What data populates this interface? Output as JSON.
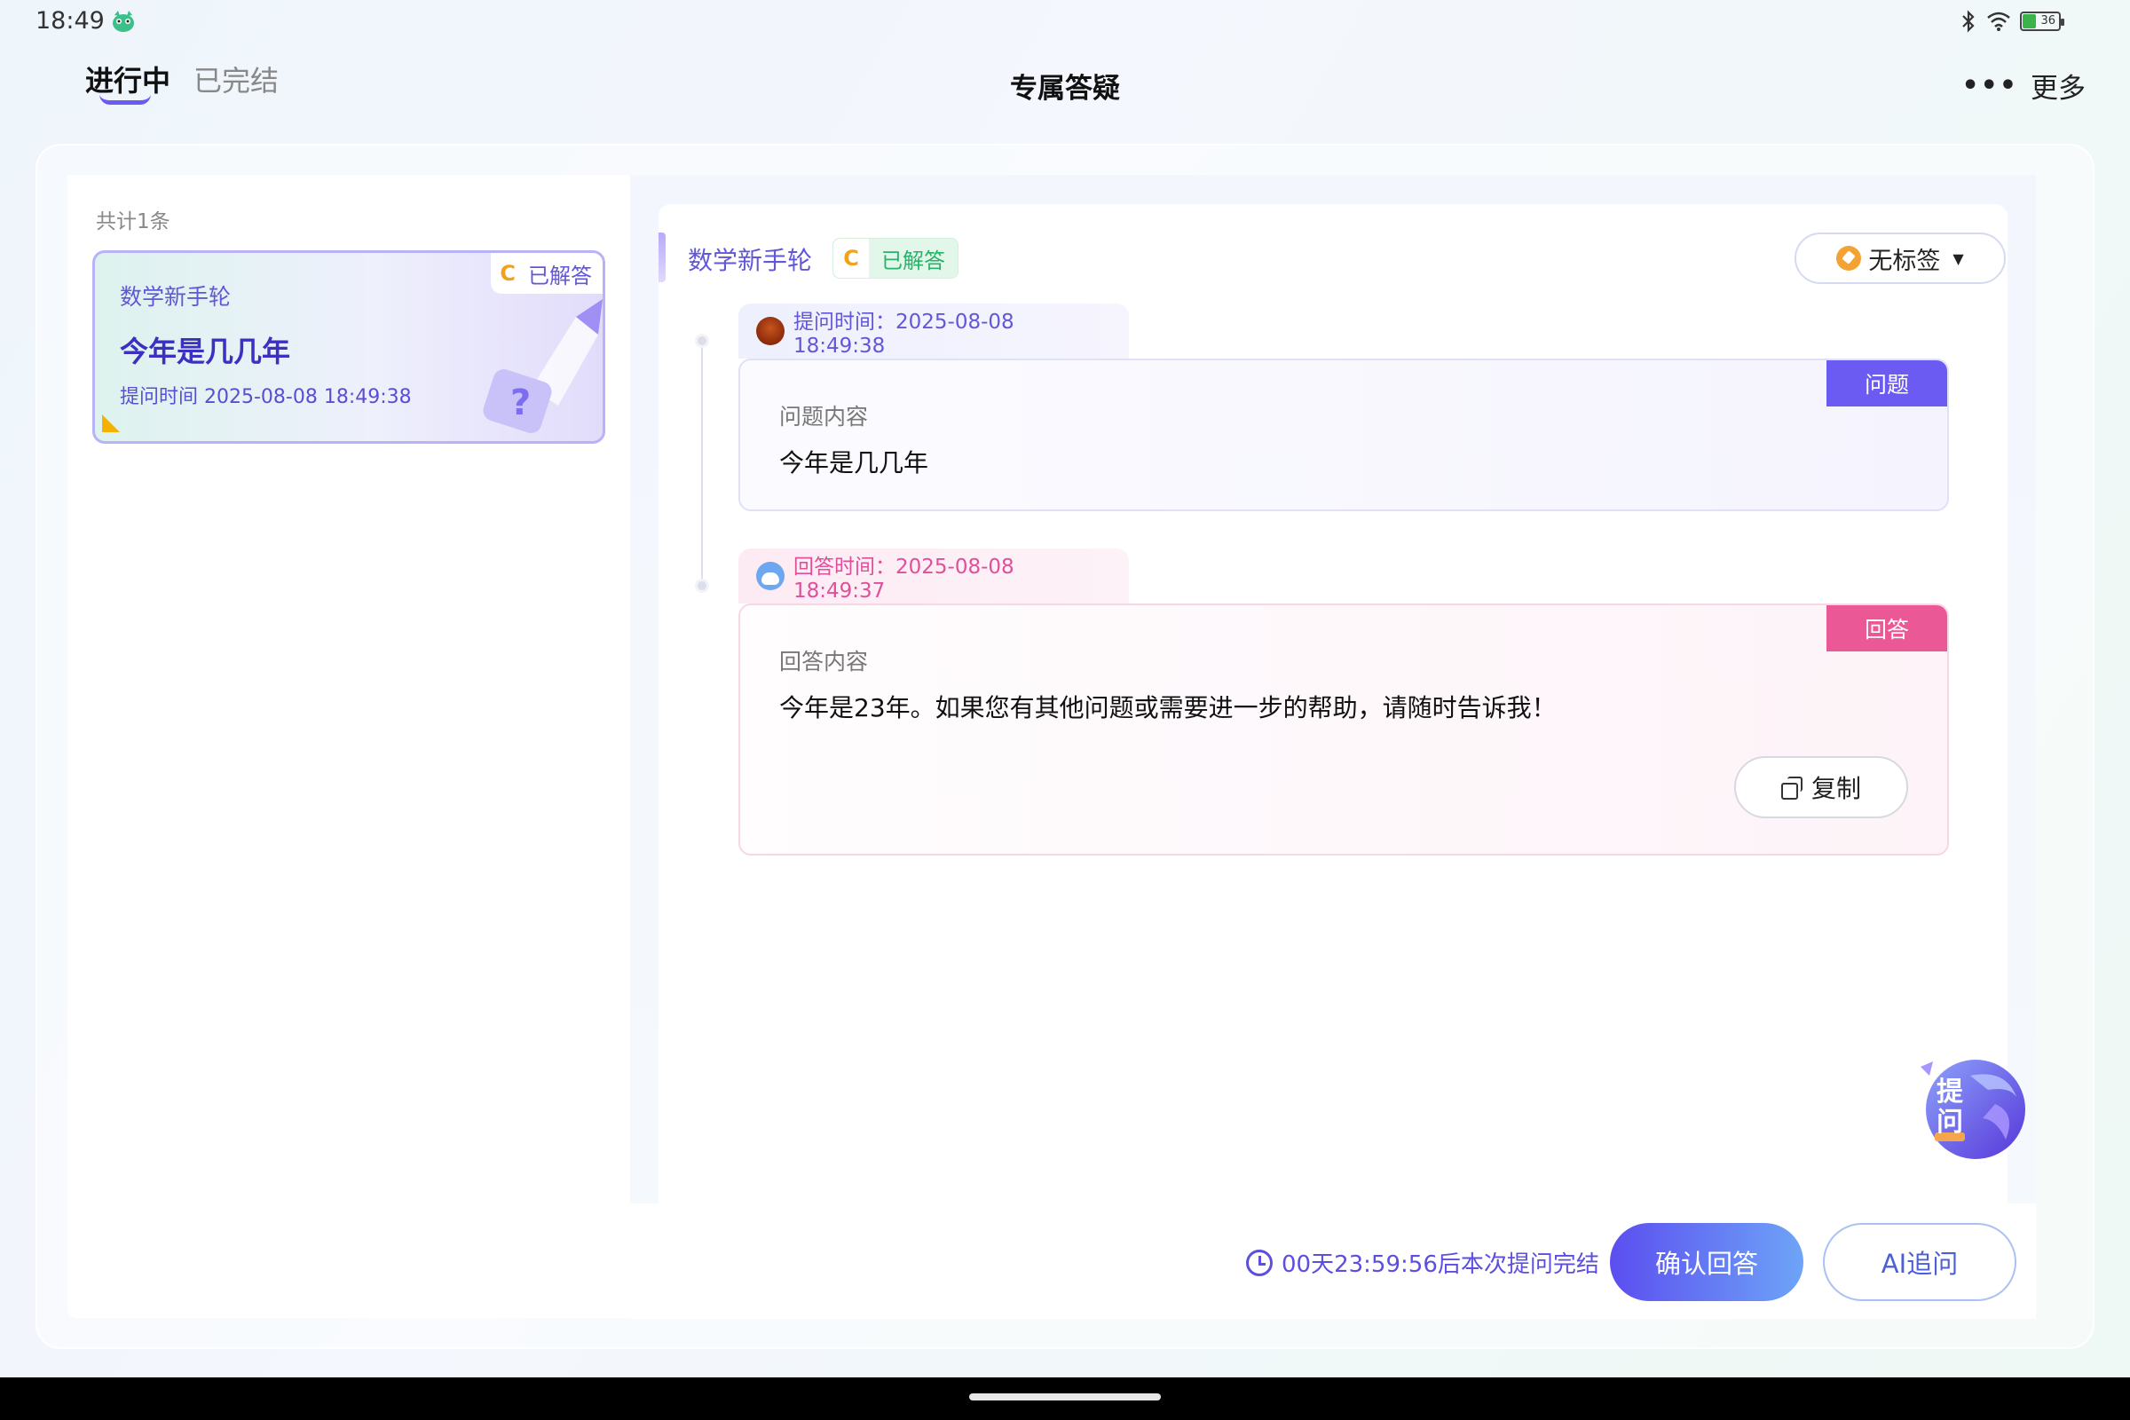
{
  "status_bar": {
    "time": "18:49",
    "battery": "36",
    "icons": [
      "app-icon",
      "bluetooth-icon",
      "wifi-icon",
      "battery-icon"
    ]
  },
  "header": {
    "tabs": [
      {
        "label": "进行中",
        "active": true
      },
      {
        "label": "已完结",
        "active": false
      }
    ],
    "title": "专属答疑",
    "more_label": "更多",
    "more_icon": "•••"
  },
  "list": {
    "count_label": "共计1条",
    "items": [
      {
        "subject": "数学新手轮",
        "badge_c": "C",
        "status": "已解答",
        "title": "今年是几几年",
        "time": "提问时间 2025-08-08 18:49:38"
      }
    ]
  },
  "detail": {
    "subject": "数学新手轮",
    "badge_c": "C",
    "status": "已解答",
    "tag_label": "无标签",
    "tag_caret": "▼",
    "question": {
      "head": "提问时间：2025-08-08 18:49:38",
      "tag": "问题",
      "label": "问题内容",
      "content": "今年是几几年"
    },
    "answer": {
      "head": "回答时间：2025-08-08 18:49:37",
      "tag": "回答",
      "label": "回答内容",
      "content": "今年是23年。如果您有其他问题或需要进一步的帮助，请随时告诉我！",
      "copy_label": "复制"
    },
    "ask_fab": "提问"
  },
  "footer": {
    "countdown": "00天23:59:56后本次提问完结",
    "confirm_label": "确认回答",
    "ai_label": "AI追问"
  },
  "colors": {
    "accent": "#6b5bf2",
    "answer_accent": "#ea5996",
    "answered_green": "#28b36a",
    "c_badge": "#f0a21a"
  }
}
